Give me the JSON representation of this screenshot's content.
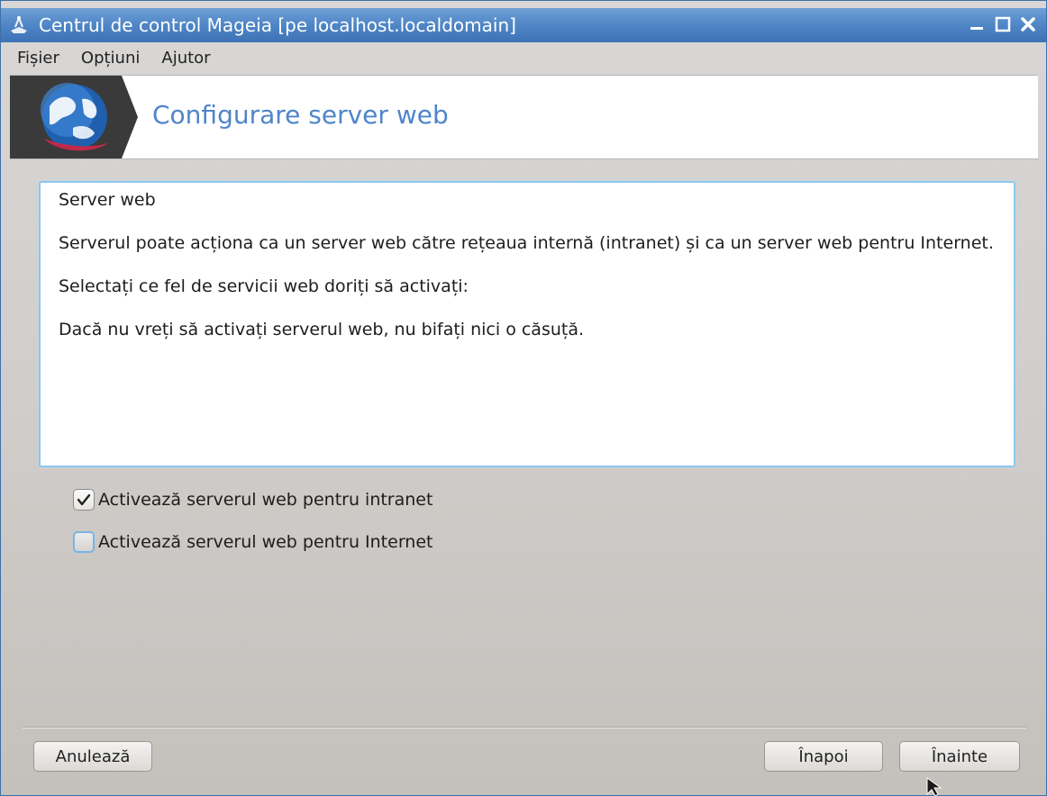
{
  "window": {
    "title": "Centrul de control Mageia  [pe localhost.localdomain]"
  },
  "menu": {
    "items": [
      "Fișier",
      "Opțiuni",
      "Ajutor"
    ]
  },
  "banner": {
    "title": "Configurare server web",
    "logo_icon": "mageia-globe-icon"
  },
  "content": {
    "heading": "Server web",
    "paragraph1": "Serverul poate acționa ca un server web către rețeaua internă (intranet) și ca un server web pentru Internet.",
    "paragraph2": "Selectați ce fel de servicii web doriți să activați:",
    "paragraph3": "Dacă nu vreți să activați serverul web, nu bifați nici o căsuță."
  },
  "options": [
    {
      "label": "Activează serverul web pentru intranet",
      "checked": true
    },
    {
      "label": "Activează serverul web pentru Internet",
      "checked": false
    }
  ],
  "buttons": {
    "cancel": "Anulează",
    "back": "Înapoi",
    "next": "Înainte"
  },
  "colors": {
    "titlebar": "#4f86c6",
    "banner_title": "#4f85c9",
    "focus_border": "#8ec6ee"
  }
}
